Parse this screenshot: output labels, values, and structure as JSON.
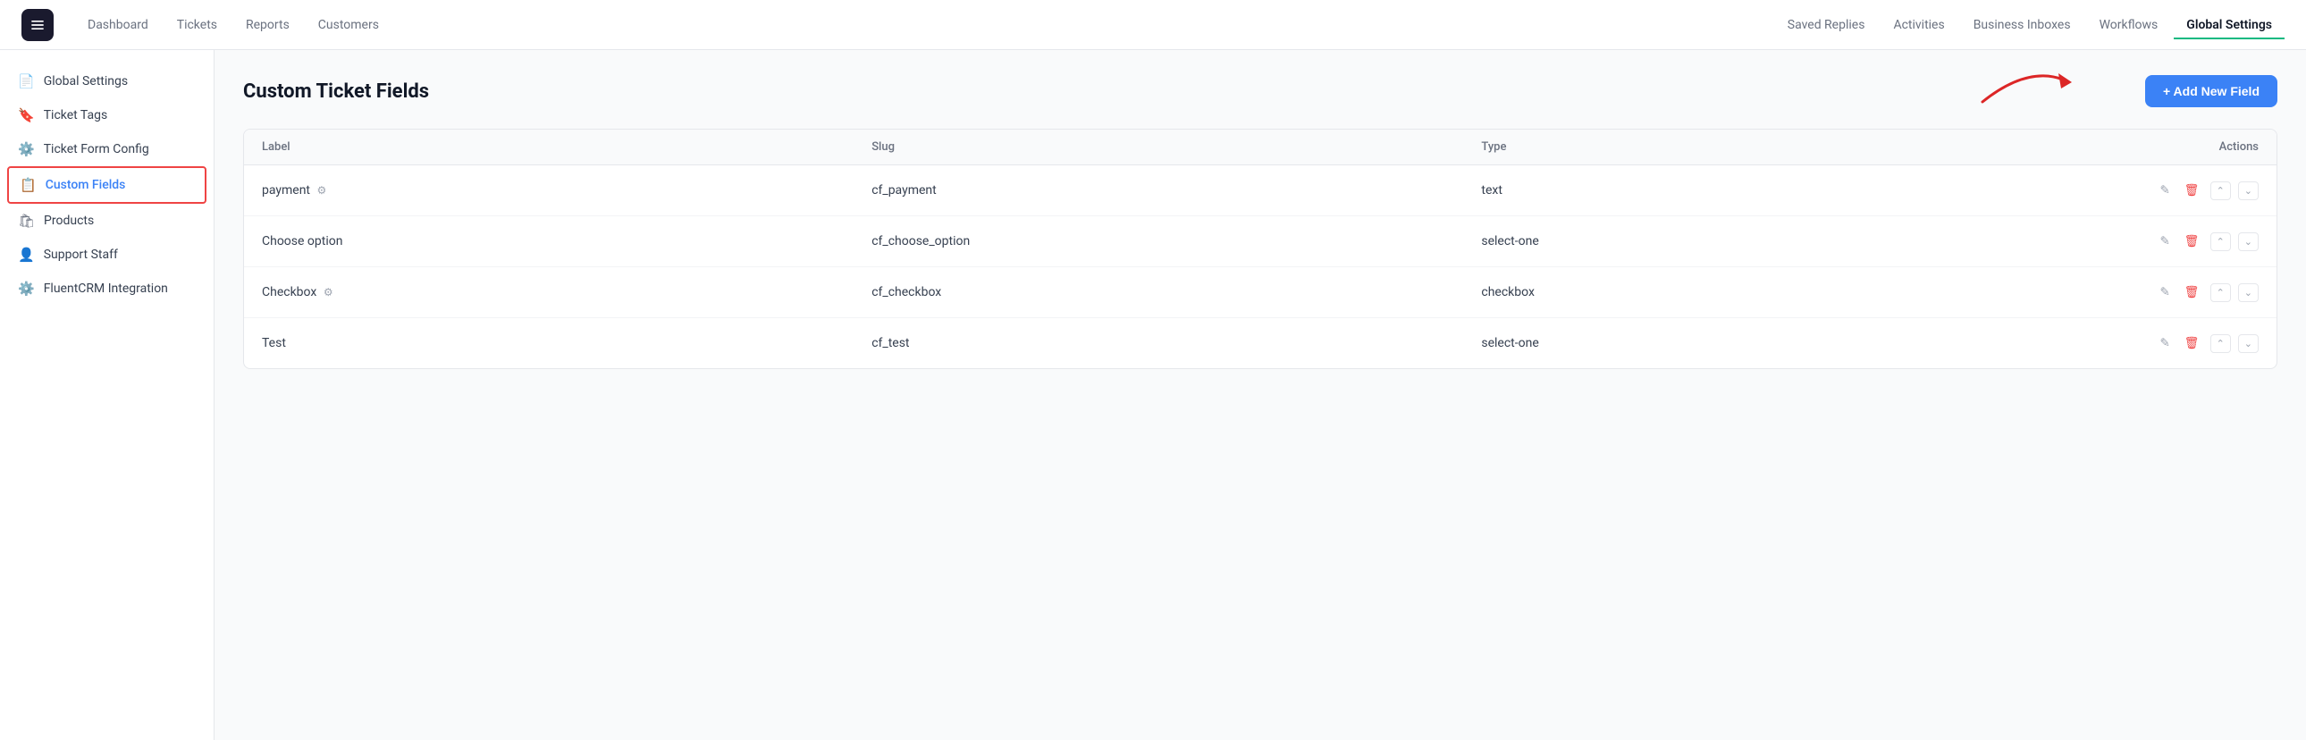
{
  "nav": {
    "left_items": [
      {
        "label": "Dashboard",
        "active": false
      },
      {
        "label": "Tickets",
        "active": false
      },
      {
        "label": "Reports",
        "active": false
      },
      {
        "label": "Customers",
        "active": false
      }
    ],
    "right_items": [
      {
        "label": "Saved Replies",
        "active": false
      },
      {
        "label": "Activities",
        "active": false
      },
      {
        "label": "Business Inboxes",
        "active": false
      },
      {
        "label": "Workflows",
        "active": false
      },
      {
        "label": "Global Settings",
        "active": true
      }
    ]
  },
  "sidebar": {
    "items": [
      {
        "label": "Global Settings",
        "icon": "📄",
        "active": false
      },
      {
        "label": "Ticket Tags",
        "icon": "🔖",
        "active": false
      },
      {
        "label": "Ticket Form Config",
        "icon": "⚙️",
        "active": false
      },
      {
        "label": "Custom Fields",
        "icon": "📋",
        "active": true
      },
      {
        "label": "Products",
        "icon": "🛍️",
        "active": false
      },
      {
        "label": "Support Staff",
        "icon": "👤",
        "active": false
      },
      {
        "label": "FluentCRM Integration",
        "icon": "⚙️",
        "active": false
      }
    ]
  },
  "main": {
    "title": "Custom Ticket Fields",
    "add_button": "+ Add New Field",
    "table": {
      "headers": [
        "Label",
        "Slug",
        "Type",
        "Actions"
      ],
      "rows": [
        {
          "label": "payment",
          "has_icon": true,
          "slug": "cf_payment",
          "type": "text"
        },
        {
          "label": "Choose option",
          "has_icon": false,
          "slug": "cf_choose_option",
          "type": "select-one"
        },
        {
          "label": "Checkbox",
          "has_icon": true,
          "slug": "cf_checkbox",
          "type": "checkbox"
        },
        {
          "label": "Test",
          "has_icon": false,
          "slug": "cf_test",
          "type": "select-one"
        }
      ]
    }
  }
}
